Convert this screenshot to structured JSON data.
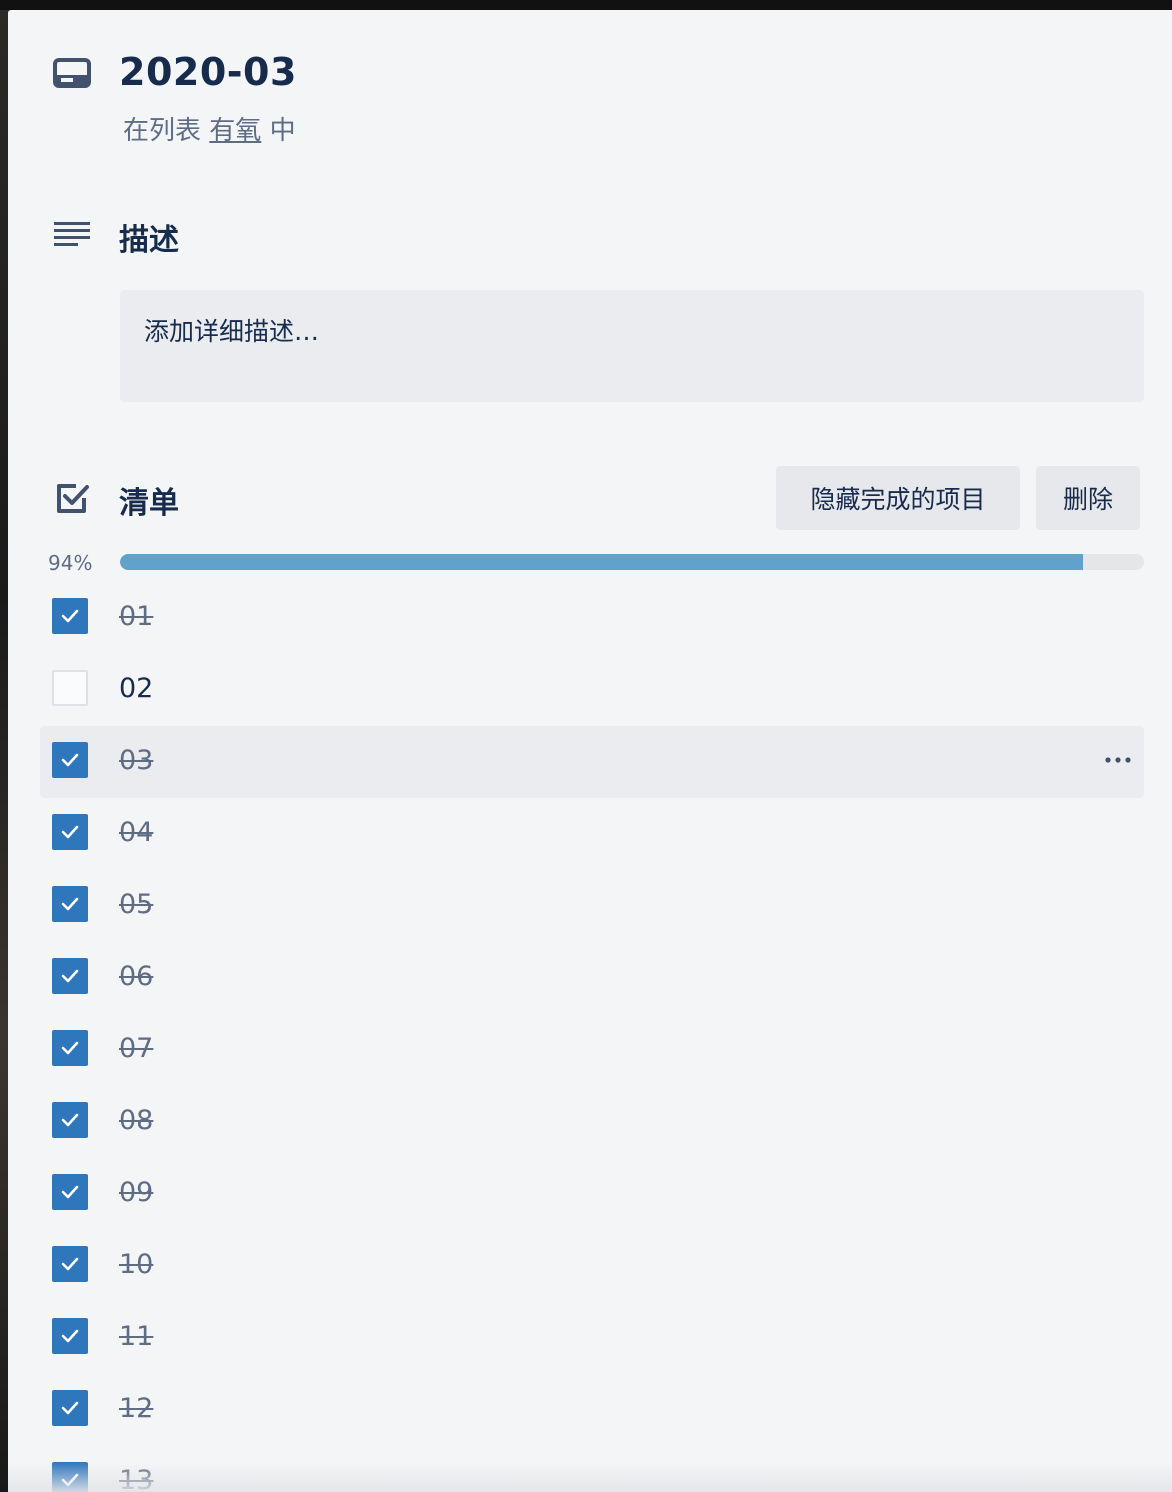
{
  "card": {
    "title": "2020-03",
    "list_prefix": "在列表",
    "list_name": "有氧",
    "list_suffix": "中",
    "card_icon": "card-icon"
  },
  "description": {
    "heading": "描述",
    "icon": "description-icon",
    "placeholder": "添加详细描述…"
  },
  "checklist": {
    "heading": "清单",
    "icon": "checklist-icon",
    "hide_completed_label": "隐藏完成的项目",
    "delete_label": "删除",
    "progress_label": "94%",
    "progress_fraction": 0.94,
    "progress_color": "#61a2cc",
    "checked_color": "#2f77bd",
    "items": [
      {
        "label": "01",
        "checked": true
      },
      {
        "label": "02",
        "checked": false
      },
      {
        "label": "03",
        "checked": true,
        "hovered": true
      },
      {
        "label": "04",
        "checked": true
      },
      {
        "label": "05",
        "checked": true
      },
      {
        "label": "06",
        "checked": true
      },
      {
        "label": "07",
        "checked": true
      },
      {
        "label": "08",
        "checked": true
      },
      {
        "label": "09",
        "checked": true
      },
      {
        "label": "10",
        "checked": true
      },
      {
        "label": "11",
        "checked": true
      },
      {
        "label": "12",
        "checked": true
      },
      {
        "label": "13",
        "checked": true
      }
    ]
  }
}
